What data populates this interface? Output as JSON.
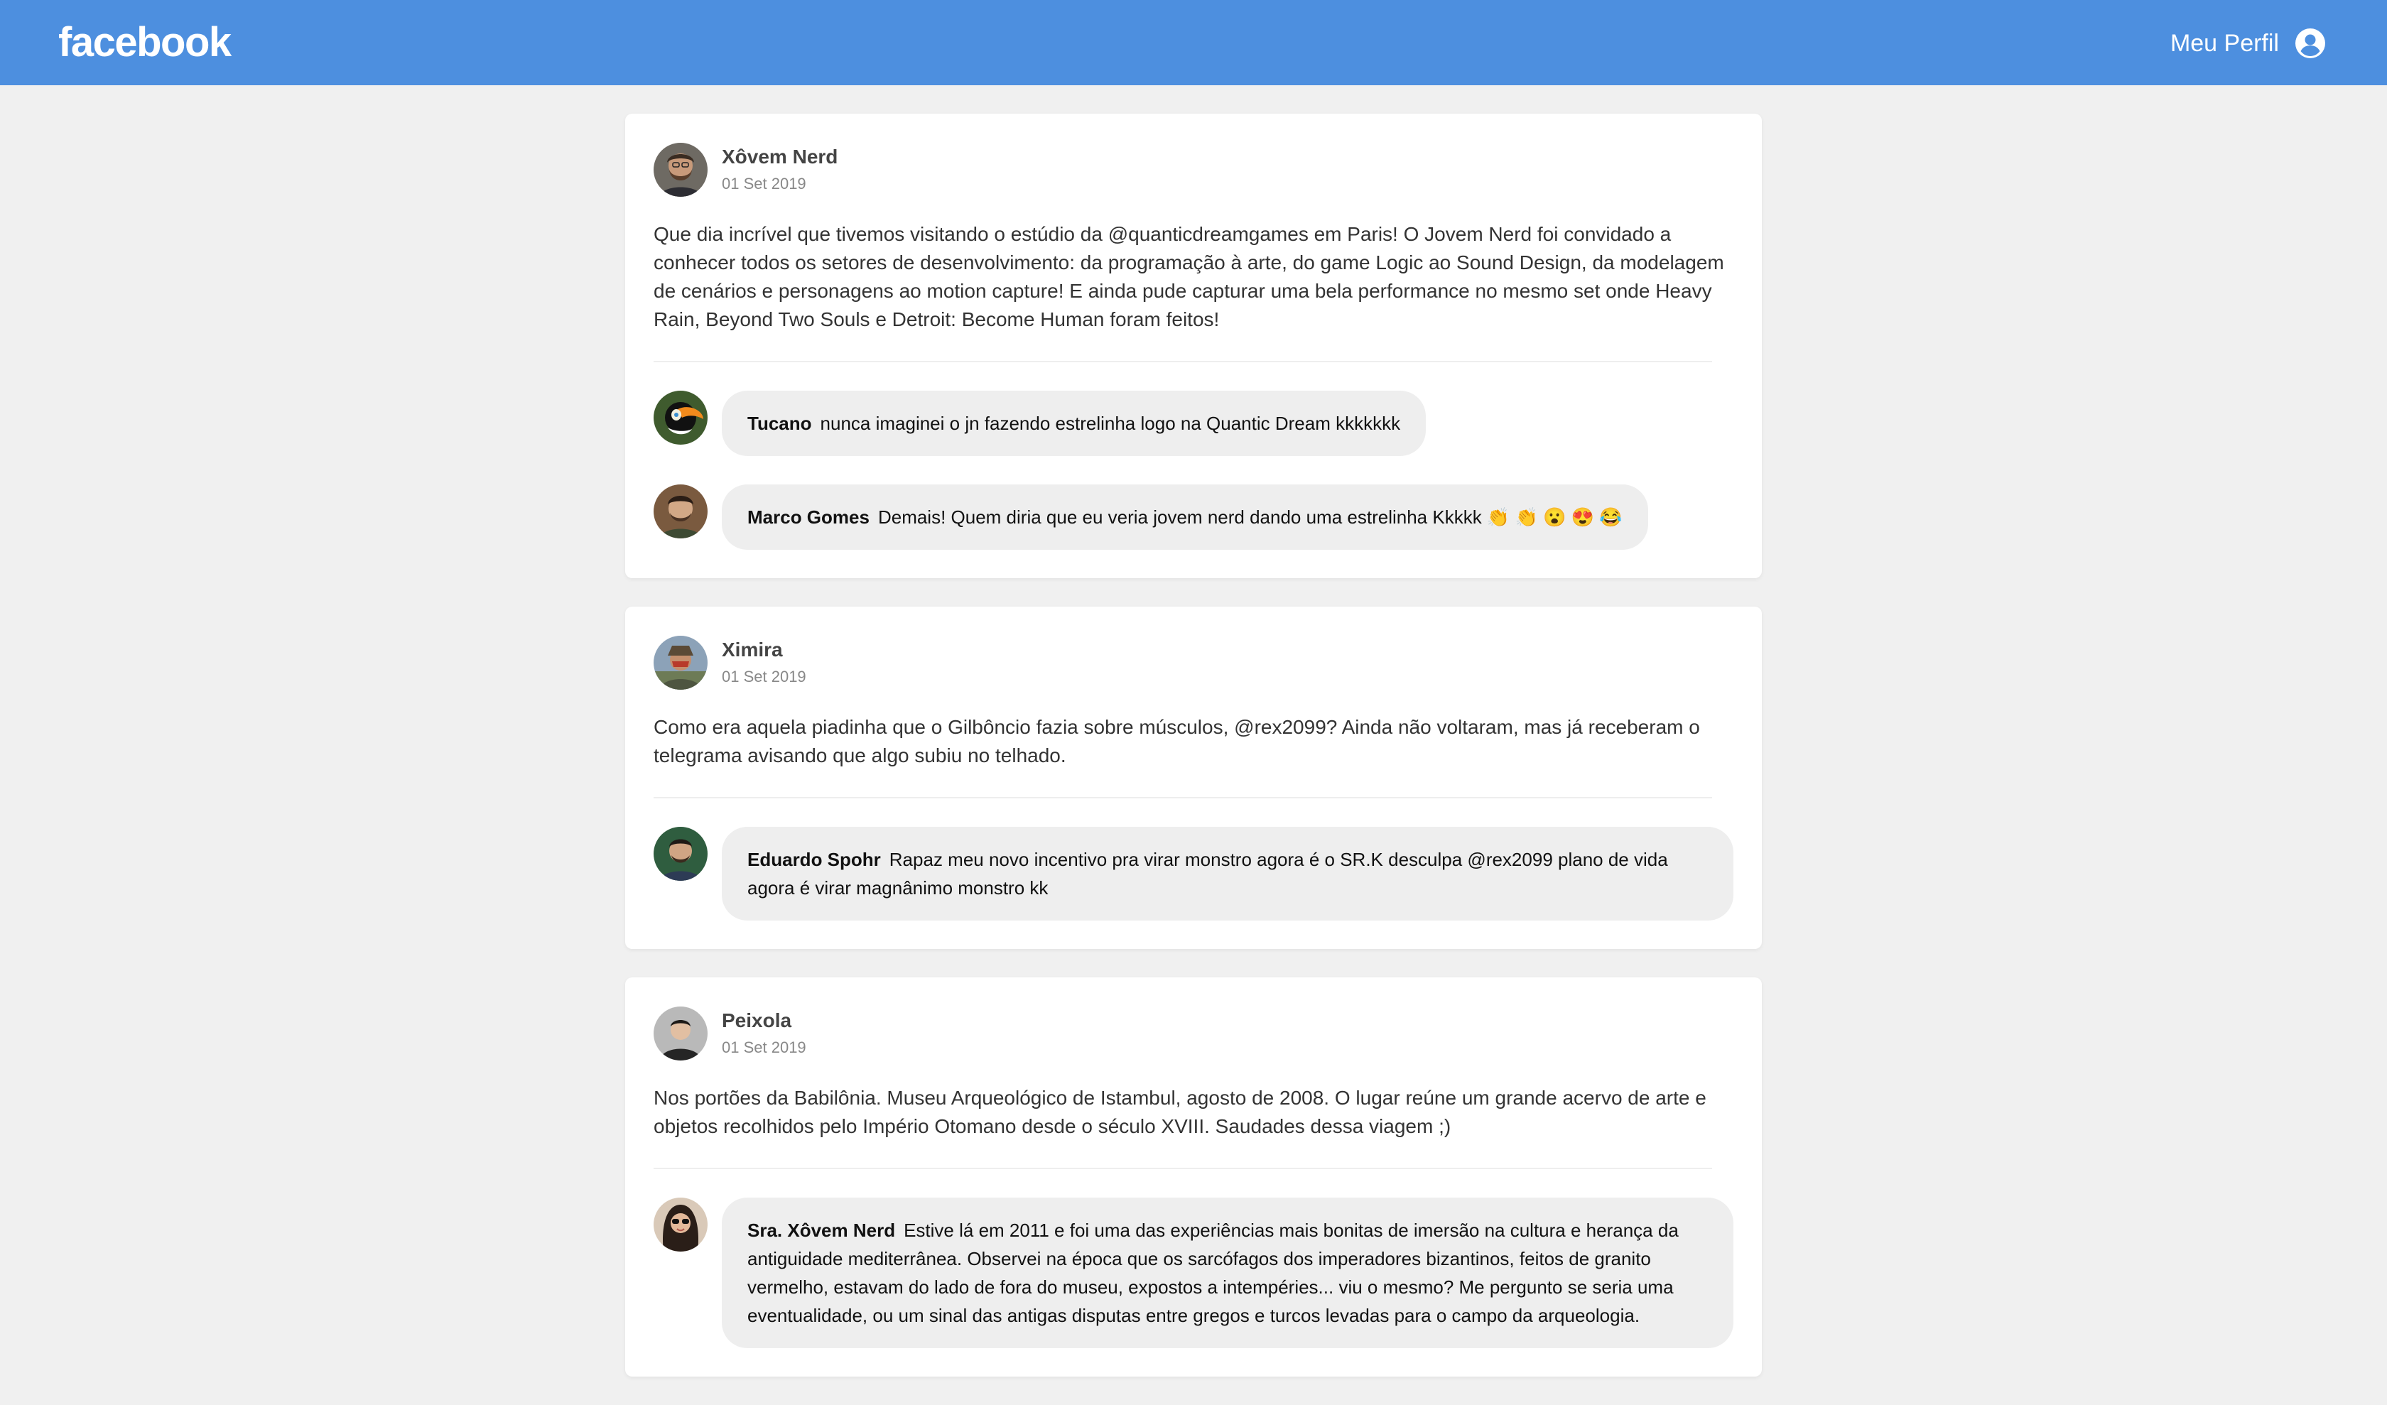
{
  "header": {
    "logo_text": "facebook",
    "profile_label": "Meu Perfil",
    "profile_icon": "user-circle-icon"
  },
  "colors": {
    "header_bg": "#4d8fdf",
    "page_bg": "#f0f0f0",
    "bubble_bg": "#eeeeee"
  },
  "posts": [
    {
      "author": "Xôvem Nerd",
      "date": "01 Set 2019",
      "text": "Que dia incrível que tivemos visitando o estúdio da @quanticdreamgames em Paris! O Jovem Nerd foi convidado a conhecer todos os setores de desenvolvimento: da programação à arte, do game Logic ao Sound Design, da modelagem de cenários e personagens ao motion capture! E ainda pude capturar uma bela performance no mesmo set onde Heavy Rain, Beyond Two Souls e Detroit: Become Human foram feitos!",
      "comments": [
        {
          "author": "Tucano",
          "text": "nunca imaginei o jn fazendo estrelinha logo na Quantic Dream kkkkkkk"
        },
        {
          "author": "Marco Gomes",
          "text": "Demais! Quem diria que eu veria jovem nerd dando uma estrelinha Kkkkk 👏 👏 😮 😍 😂"
        }
      ]
    },
    {
      "author": "Ximira",
      "date": "01 Set 2019",
      "text": "Como era aquela piadinha que o Gilbôncio fazia sobre músculos, @rex2099? Ainda não voltaram, mas já receberam o telegrama avisando que algo subiu no telhado.",
      "comments": [
        {
          "author": "Eduardo Spohr",
          "text": "Rapaz meu novo incentivo pra virar monstro agora é o SR.K desculpa @rex2099 plano de vida agora é virar magnânimo monstro kk"
        }
      ]
    },
    {
      "author": "Peixola",
      "date": "01 Set 2019",
      "text": "Nos portões da Babilônia. Museu Arqueológico de Istambul, agosto de 2008. O lugar reúne um grande acervo de arte e objetos recolhidos pelo Império Otomano desde o século XVIII. Saudades dessa viagem ;)",
      "comments": [
        {
          "author": "Sra. Xôvem Nerd",
          "text": "Estive lá em 2011 e foi uma das experiências mais bonitas de imersão na cultura e herança da antiguidade mediterrânea. Observei na época que os sarcófagos dos imperadores bizantinos, feitos de granito vermelho, estavam do lado de fora do museu, expostos a intempéries... viu o mesmo? Me pergunto se seria uma eventualidade, ou um sinal das antigas disputas entre gregos e turcos levadas para o campo da arqueologia."
        }
      ]
    }
  ]
}
